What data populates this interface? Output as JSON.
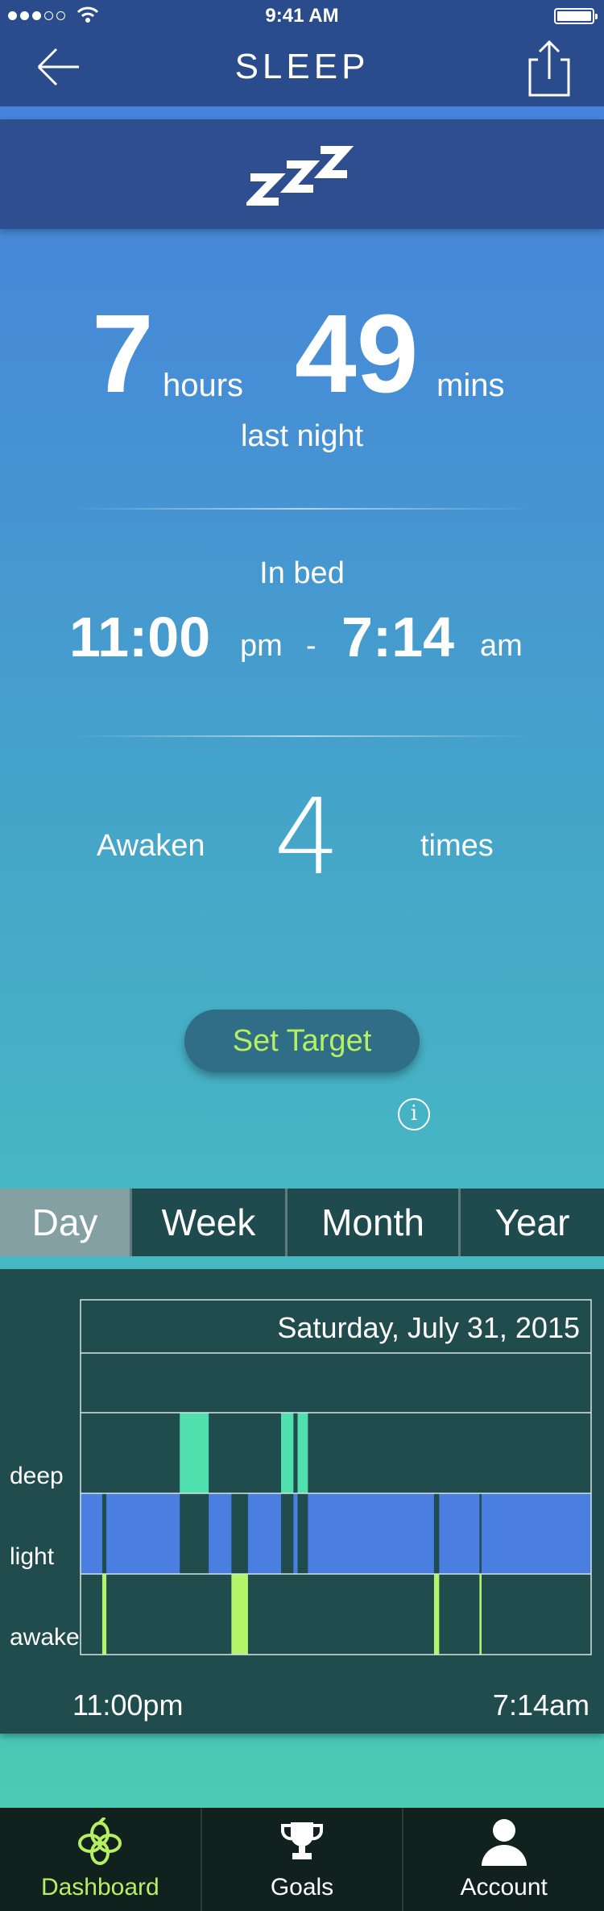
{
  "status_bar": {
    "time": "9:41 AM"
  },
  "nav": {
    "title": "SLEEP"
  },
  "banner": {
    "icon": "zzz-icon"
  },
  "duration": {
    "hours": "7",
    "hours_unit": "hours",
    "mins": "49",
    "mins_unit": "mins",
    "caption": "last night"
  },
  "in_bed": {
    "label": "In bed",
    "start": "11:00",
    "start_period": "pm",
    "separator": "-",
    "end": "7:14",
    "end_period": "am"
  },
  "awaken": {
    "label": "Awaken",
    "count": "4",
    "suffix": "times"
  },
  "target_button": {
    "label": "Set Target"
  },
  "info": {
    "glyph": "i"
  },
  "periods": [
    "Day",
    "Week",
    "Month",
    "Year"
  ],
  "selected_period": "Day",
  "chart_data": {
    "type": "timeline",
    "date": "Saturday, July 31, 2015",
    "rows": [
      "deep",
      "light",
      "awake"
    ],
    "x_start_label": "11:00pm",
    "x_end_label": "7:14am",
    "colors": {
      "deep": "#4fe0ae",
      "light": "#4a7ee0",
      "awake": "#b4f56a",
      "background": "#204c4d"
    },
    "segments": [
      {
        "stage": "light",
        "start": "11:00pm",
        "end": "11:21pm"
      },
      {
        "stage": "awake",
        "start": "11:21pm",
        "end": "11:25pm"
      },
      {
        "stage": "light",
        "start": "11:25pm",
        "end": "12:36am"
      },
      {
        "stage": "deep",
        "start": "12:36am",
        "end": "1:04am"
      },
      {
        "stage": "light",
        "start": "1:04am",
        "end": "1:26am"
      },
      {
        "stage": "awake",
        "start": "1:26am",
        "end": "1:42am"
      },
      {
        "stage": "light",
        "start": "1:42am",
        "end": "2:14am"
      },
      {
        "stage": "deep",
        "start": "2:14am",
        "end": "2:26am"
      },
      {
        "stage": "light",
        "start": "2:26am",
        "end": "2:30am"
      },
      {
        "stage": "deep",
        "start": "2:30am",
        "end": "2:40am"
      },
      {
        "stage": "light",
        "start": "2:40am",
        "end": "4:42am"
      },
      {
        "stage": "awake",
        "start": "4:42am",
        "end": "4:47am"
      },
      {
        "stage": "light",
        "start": "4:47am",
        "end": "5:26am"
      },
      {
        "stage": "awake",
        "start": "5:26am",
        "end": "5:28am"
      },
      {
        "stage": "light",
        "start": "5:28am",
        "end": "7:14am"
      }
    ]
  },
  "tabbar": {
    "items": [
      {
        "label": "Dashboard",
        "icon": "dashboard-icon",
        "active": true
      },
      {
        "label": "Goals",
        "icon": "trophy-icon",
        "active": false
      },
      {
        "label": "Account",
        "icon": "person-icon",
        "active": false
      }
    ],
    "active_color": "#b6ef62"
  }
}
